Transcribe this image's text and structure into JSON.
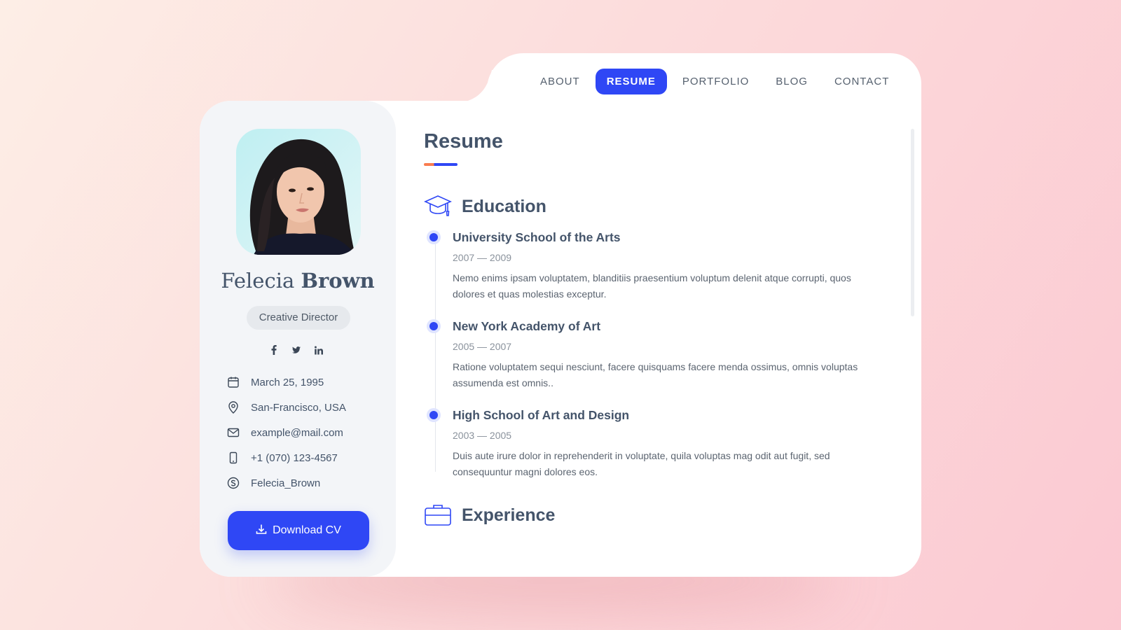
{
  "nav": {
    "items": [
      {
        "label": "ABOUT",
        "active": false
      },
      {
        "label": "RESUME",
        "active": true
      },
      {
        "label": "PORTFOLIO",
        "active": false
      },
      {
        "label": "BLOG",
        "active": false
      },
      {
        "label": "CONTACT",
        "active": false
      }
    ]
  },
  "profile": {
    "first_name": "Felecia",
    "last_name": "Brown",
    "role": "Creative Director",
    "socials": [
      "facebook-icon",
      "twitter-icon",
      "linkedin-icon"
    ],
    "info": [
      {
        "icon": "calendar-icon",
        "text": "March 25, 1995"
      },
      {
        "icon": "location-pin-icon",
        "text": "San-Francisco, USA"
      },
      {
        "icon": "mail-icon",
        "text": "example@mail.com"
      },
      {
        "icon": "phone-icon",
        "text": "+1 (070) 123-4567"
      },
      {
        "icon": "skype-icon",
        "text": "Felecia_Brown"
      }
    ],
    "download_label": "Download CV"
  },
  "resume": {
    "title": "Resume",
    "education_heading": "Education",
    "education": [
      {
        "school": "University School of the Arts",
        "period": "2007 — 2009",
        "description": "Nemo enims ipsam voluptatem, blanditiis praesentium voluptum delenit atque corrupti, quos dolores et quas molestias exceptur."
      },
      {
        "school": "New York Academy of Art",
        "period": "2005 — 2007",
        "description": "Ratione voluptatem sequi nesciunt, facere quisquams facere menda ossimus, omnis voluptas assumenda est omnis.."
      },
      {
        "school": "High School of Art and Design",
        "period": "2003 — 2005",
        "description": "Duis aute irure dolor in reprehenderit in voluptate, quila voluptas mag odit aut fugit, sed consequuntur magni dolores eos."
      }
    ],
    "experience_heading": "Experience"
  },
  "colors": {
    "accent": "#2f47f5",
    "accent_secondary": "#f97c4f",
    "text": "#44546a"
  }
}
